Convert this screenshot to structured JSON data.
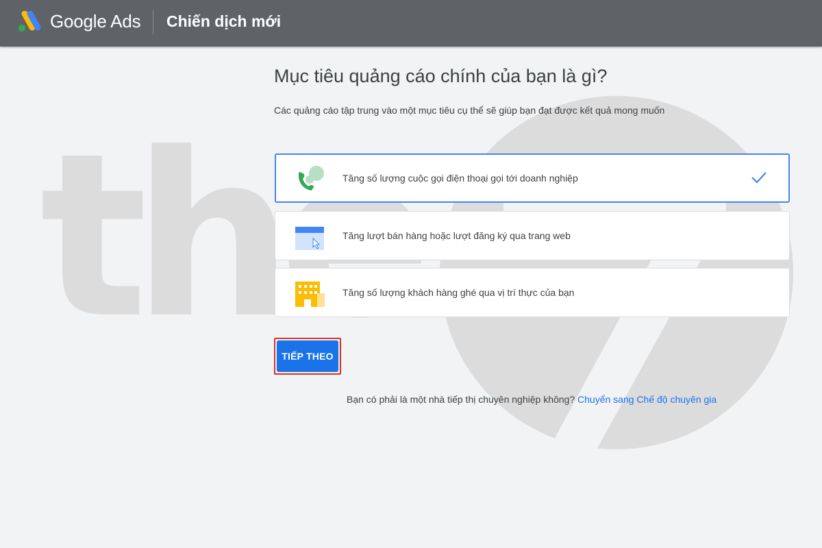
{
  "header": {
    "product_name": "Google Ads",
    "page_title": "Chiến dịch mới",
    "logo_icon": "google-ads-logo"
  },
  "main": {
    "heading": "Mục tiêu quảng cáo chính của bạn là gì?",
    "subheading": "Các quảng cáo tập trung vào một mục tiêu cụ thể sẽ giúp bạn đạt được kết quả mong muốn",
    "options": [
      {
        "label": "Tăng số lượng cuộc gọi điện thoại gọi tới doanh nghiệp",
        "icon": "phone-call-icon",
        "selected": true
      },
      {
        "label": "Tăng lượt bán hàng hoặc lượt đăng ký qua trang web",
        "icon": "website-click-icon",
        "selected": false
      },
      {
        "label": "Tăng số lượng khách hàng ghé qua vị trí thực của bạn",
        "icon": "storefront-icon",
        "selected": false
      }
    ],
    "next_button": "TIẾP THEO",
    "footer_question": "Bạn có phải là một nhà tiếp thị chuyên nghiệp không?",
    "footer_link": "Chuyển sang Chế độ chuyên gia"
  },
  "watermark": {
    "text": "the"
  },
  "colors": {
    "topbar": "#5f6368",
    "accent": "#1a73e8",
    "selected_border": "#4285f4",
    "highlight_outline": "#d93025"
  }
}
